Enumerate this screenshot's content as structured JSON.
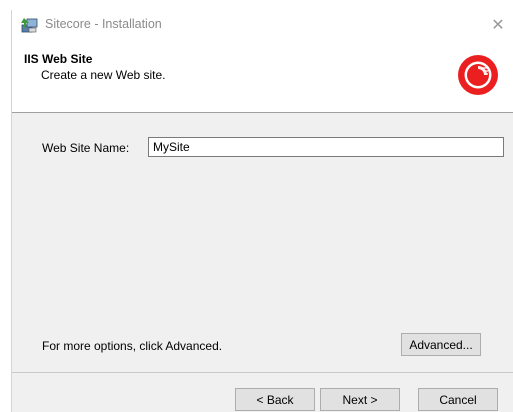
{
  "window": {
    "title": "Sitecore - Installation",
    "close_symbol": "✕"
  },
  "header": {
    "title": "IIS Web Site",
    "subtitle": "Create a new Web site.",
    "logo_icon": "sitecore-logo-icon",
    "logo_color": "#eb1f1f"
  },
  "form": {
    "site_name_label": "Web Site Name:",
    "site_name_value": "MySite"
  },
  "options": {
    "hint": "For more options, click Advanced.",
    "advanced_label": "Advanced..."
  },
  "footer": {
    "back_label": "< Back",
    "next_label": "Next >",
    "cancel_label": "Cancel"
  }
}
